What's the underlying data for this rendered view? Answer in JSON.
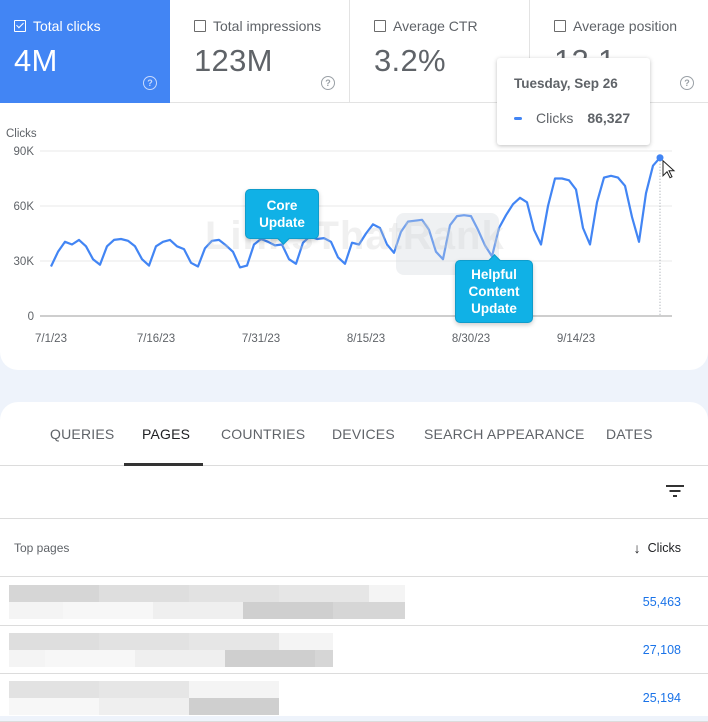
{
  "metrics": [
    {
      "label": "Total clicks",
      "value": "4M",
      "checked": true
    },
    {
      "label": "Total impressions",
      "value": "123M",
      "checked": false
    },
    {
      "label": "Average CTR",
      "value": "3.2%",
      "checked": false
    },
    {
      "label": "Average position",
      "value": "12.1",
      "checked": false
    }
  ],
  "help_glyph": "?",
  "tooltip": {
    "date": "Tuesday, Sep 26",
    "series": "Clicks",
    "value": "86,327"
  },
  "annotations": {
    "core": "Core Update",
    "hcu": "Helpful Content Update"
  },
  "watermark": "LinksThatRank",
  "colors": {
    "accent": "#4285f4",
    "annotation": "#10b1e6",
    "link": "#1a73e8"
  },
  "chart_data": {
    "type": "line",
    "title": "",
    "ylabel": "Clicks",
    "xlabel": "",
    "ylim": [
      0,
      90000
    ],
    "yticks": [
      "0",
      "30K",
      "60K",
      "90K"
    ],
    "ytick_values": [
      0,
      30000,
      60000,
      90000
    ],
    "xticks": [
      "7/1/23",
      "7/16/23",
      "7/31/23",
      "8/15/23",
      "8/30/23",
      "9/14/23"
    ],
    "xtick_index": [
      0,
      15,
      30,
      45,
      60,
      75
    ],
    "x_start": "7/1/23",
    "x_end": "9/26/23",
    "grid": true,
    "series": [
      {
        "name": "Clicks",
        "values": [
          27000,
          35000,
          40500,
          39000,
          41500,
          38000,
          31000,
          28000,
          38000,
          41500,
          42000,
          41000,
          38000,
          31000,
          27500,
          38000,
          40500,
          41500,
          38000,
          36500,
          29000,
          27000,
          37000,
          41000,
          41500,
          38500,
          35000,
          26500,
          27500,
          39000,
          42000,
          40500,
          38500,
          39000,
          31000,
          28500,
          40000,
          43500,
          42000,
          42500,
          40500,
          32000,
          28500,
          40000,
          39000,
          45000,
          50000,
          48000,
          39000,
          34500,
          46000,
          51500,
          52000,
          52500,
          47000,
          35000,
          31000,
          49500,
          54500,
          55000,
          54500,
          47000,
          38500,
          32500,
          48000,
          55000,
          61000,
          64500,
          62000,
          47000,
          39000,
          60000,
          75000,
          75000,
          74000,
          69000,
          48000,
          39000,
          62000,
          75500,
          76500,
          75500,
          71000,
          54000,
          40500,
          67000,
          82000,
          86327
        ]
      }
    ],
    "highlight": {
      "date": "9/26/23",
      "value": 86327
    },
    "annotations": [
      {
        "text": "Core Update",
        "date": "8/5/23"
      },
      {
        "text": "Helpful Content Update",
        "date": "9/4/23"
      }
    ]
  },
  "tabs": [
    {
      "label": "QUERIES",
      "active": false
    },
    {
      "label": "PAGES",
      "active": true
    },
    {
      "label": "COUNTRIES",
      "active": false
    },
    {
      "label": "DEVICES",
      "active": false
    },
    {
      "label": "SEARCH APPEARANCE",
      "active": false
    },
    {
      "label": "DATES",
      "active": false
    }
  ],
  "table": {
    "header_left": "Top pages",
    "header_right": "Clicks",
    "sort_glyph": "↓",
    "rows": [
      {
        "page": "",
        "clicks": "55,463"
      },
      {
        "page": "",
        "clicks": "27,108"
      },
      {
        "page": "",
        "clicks": "25,194"
      }
    ]
  }
}
